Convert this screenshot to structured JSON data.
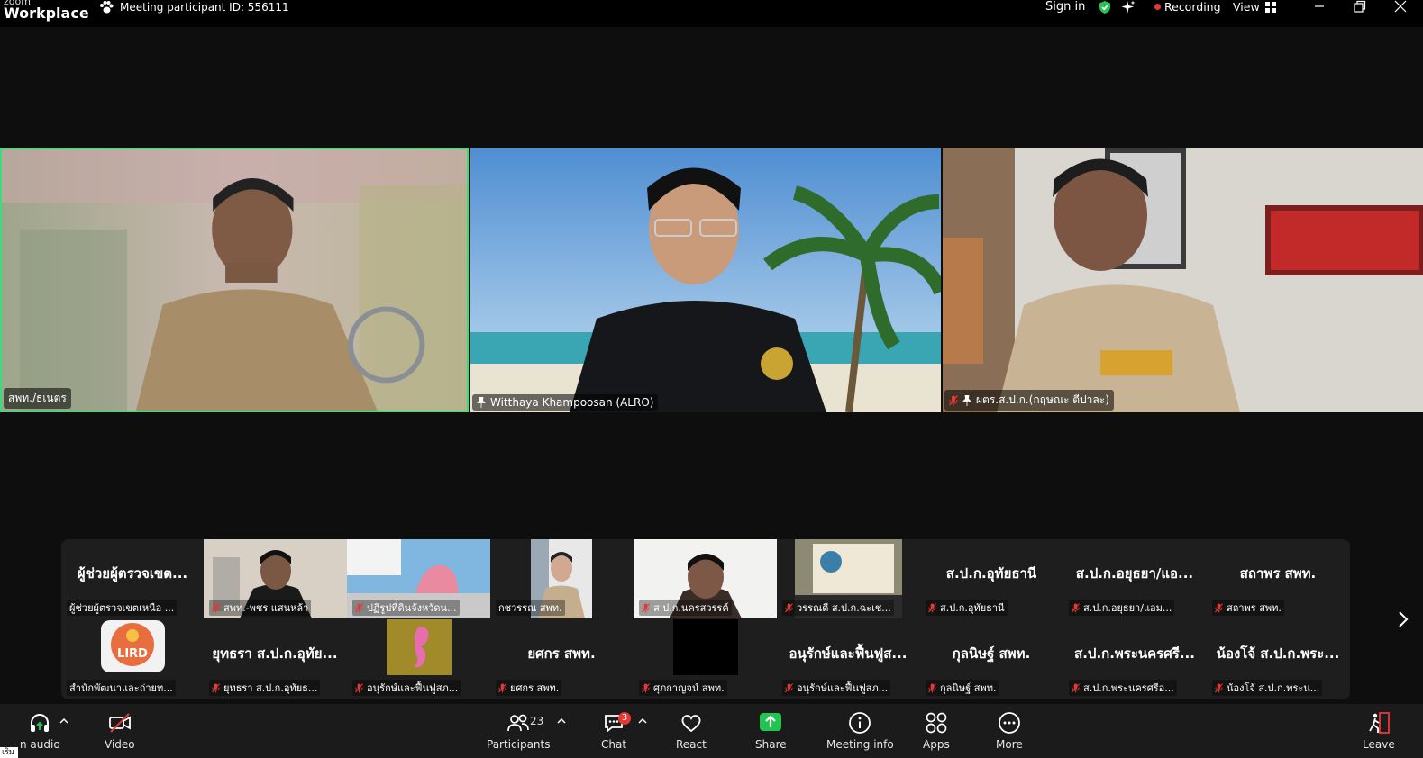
{
  "app": {
    "brand_top": "zoom",
    "brand_bottom": "Workplace"
  },
  "titlebar": {
    "meeting_id": "Meeting participant ID: 556111",
    "sign_in": "Sign in",
    "recording": "Recording",
    "view": "View"
  },
  "tiles": [
    {
      "name": "สพท./ธเนตร",
      "muted": false,
      "active_speaker": true
    },
    {
      "name": "Witthaya Khampoosan (ALRO)",
      "muted": false,
      "pinned": true
    },
    {
      "name": "ผตร.ส.ป.ก.(กฤษณะ ตีปาละ)",
      "muted": true,
      "pinned": true
    }
  ],
  "gallery_row1": [
    {
      "big": "ผู้ช่วยผู้ตรวจเขต...",
      "cap": "ผู้ช่วยผู้ตรวจเขตเหนือ ...",
      "muted": false
    },
    {
      "big": "",
      "cap": "สพท.-พชร แสนหล้า",
      "muted": true,
      "video": true
    },
    {
      "big": "",
      "cap": "ปฏิรูปที่ดินจังหวัดน...",
      "muted": true,
      "video": true
    },
    {
      "big": "",
      "cap": "กชวรรณ สพท.",
      "muted": false,
      "video": true
    },
    {
      "big": "",
      "cap": "ส.ป.ก.นครสวรรค์",
      "muted": true,
      "video": true
    },
    {
      "big": "",
      "cap": "วรรณดี ส.ป.ก.ฉะเช...",
      "muted": true,
      "video": true
    },
    {
      "big": "ส.ป.ก.อุทัยธานี",
      "cap": "ส.ป.ก.อุทัยธานี",
      "muted": true
    },
    {
      "big": "ส.ป.ก.อยุธยา/แอ...",
      "cap": "ส.ป.ก.อยุธยา/แอม...",
      "muted": true
    },
    {
      "big": "สถาพร สพท.",
      "cap": "สถาพร สพท.",
      "muted": true
    }
  ],
  "gallery_row2": [
    {
      "big": "",
      "cap": "สำนักพัฒนาและถ่ายท...",
      "muted": false,
      "logo_text": "LIRD"
    },
    {
      "big": "ยุทธรา ส.ป.ก.อุทัย...",
      "cap": "ยุทธรา ส.ป.ก.อุทัยธ...",
      "muted": true
    },
    {
      "big": "",
      "cap": "อนุรักษ์และฟื้นฟูสภ...",
      "muted": true,
      "seahorse": true
    },
    {
      "big": "ยศกร สพท.",
      "cap": "ยศกร สพท.",
      "muted": true
    },
    {
      "big": "",
      "cap": "ศุภกาญจน์  สพท.",
      "muted": true,
      "black": true
    },
    {
      "big": "อนุรักษ์และฟื้นฟูส...",
      "cap": "อนุรักษ์และฟื้นฟูสภ...",
      "muted": true
    },
    {
      "big": "กุลนิษฐ์ สพท.",
      "cap": "กุลนิษฐ์ สพท.",
      "muted": true
    },
    {
      "big": "ส.ป.ก.พระนครศรี...",
      "cap": "ส.ป.ก.พระนครศรีอ...",
      "muted": true
    },
    {
      "big": "น้องโจ้ ส.ป.ก.พระ...",
      "cap": "น้องโจ้ ส.ป.ก.พระน...",
      "muted": true
    }
  ],
  "toolbar": {
    "audio": "n audio",
    "video": "Video",
    "participants": "Participants",
    "participants_count": "23",
    "chat": "Chat",
    "chat_badge": "3",
    "react": "React",
    "share": "Share",
    "meeting_info": "Meeting info",
    "apps": "Apps",
    "more": "More",
    "leave": "Leave"
  },
  "taskbar_corner": "เริ่ม",
  "colors": {
    "accent_green": "#3ddb7f",
    "share_green": "#23c552",
    "recording_red": "#e53935",
    "leave_red": "#e53935"
  }
}
